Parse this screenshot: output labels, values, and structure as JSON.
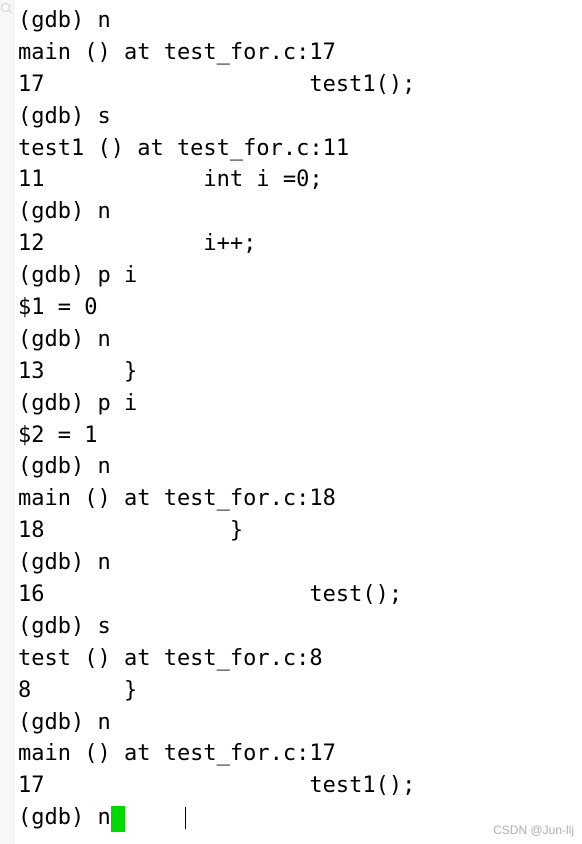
{
  "lines": [
    {
      "prompt": "(gdb) ",
      "cmd": "n"
    },
    {
      "text": "main () at test_for.c:17"
    },
    {
      "text": "17                    test1();"
    },
    {
      "prompt": "(gdb) ",
      "cmd": "s"
    },
    {
      "text": "test1 () at test_for.c:11"
    },
    {
      "text": "11            int i =0;"
    },
    {
      "prompt": "(gdb) ",
      "cmd": "n"
    },
    {
      "text": "12            i++;"
    },
    {
      "prompt": "(gdb) ",
      "cmd": "p i"
    },
    {
      "text": "$1 = 0"
    },
    {
      "prompt": "(gdb) ",
      "cmd": "n"
    },
    {
      "text": "13      }"
    },
    {
      "prompt": "(gdb) ",
      "cmd": "p i"
    },
    {
      "text": "$2 = 1"
    },
    {
      "prompt": "(gdb) ",
      "cmd": "n"
    },
    {
      "text": "main () at test_for.c:18"
    },
    {
      "text": "18              }"
    },
    {
      "prompt": "(gdb) ",
      "cmd": "n"
    },
    {
      "text": "16                    test();"
    },
    {
      "prompt": "(gdb) ",
      "cmd": "s"
    },
    {
      "text": "test () at test_for.c:8"
    },
    {
      "text": "8       }"
    },
    {
      "prompt": "(gdb) ",
      "cmd": "n"
    },
    {
      "text": "main () at test_for.c:17"
    },
    {
      "text": "17                    test1();"
    },
    {
      "prompt": "(gdb) ",
      "cmd": "n",
      "cursor": true,
      "textcursor": true
    }
  ],
  "watermark": "CSDN @Jun-llj"
}
